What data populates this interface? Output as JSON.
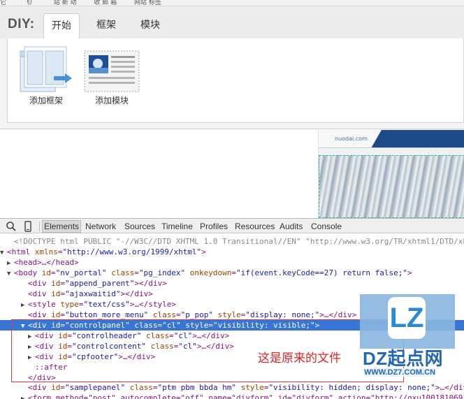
{
  "browser_strip": [
    "它",
    "飞ㄏ",
    "站 新 动",
    "收 邮 箱",
    "网站 标签"
  ],
  "diy": {
    "label": "DIY:",
    "tabs": [
      {
        "label": "开始",
        "active": true
      },
      {
        "label": "框架",
        "active": false
      },
      {
        "label": "模块",
        "active": false
      }
    ],
    "tools": {
      "add_frame": "添加框架",
      "add_module": "添加模块"
    }
  },
  "page": {
    "banner_text": "nuodai.com"
  },
  "devtools": {
    "tabs": [
      "Elements",
      "Network",
      "Sources",
      "Timeline",
      "Profiles",
      "Resources",
      "Audits",
      "Console"
    ],
    "active_tab": "Elements",
    "lines": {
      "l0": "<!DOCTYPE html PUBLIC \"-//W3C//DTD XHTML 1.0 Transitional//EN\" \"http://www.w3.org/TR/xhtml1/DTD/xh",
      "l1_tag": "<html ",
      "l1_attr": "xmlns",
      "l1_val": "\"http://www.w3.org/1999/xhtml\"",
      "l2": "<head>…</head>",
      "l3_tag": "<body ",
      "l3_a1": "id",
      "l3_v1": "\"nv_portal\"",
      "l3_a2": "class",
      "l3_v2": "\"pg_index\"",
      "l3_a3": "onkeydown",
      "l3_v3": "\"if(event.keyCode==27) return false;\"",
      "l4_a": "id",
      "l4_v": "\"append_parent\"",
      "l5_a": "id",
      "l5_v": "\"ajaxwaitid\"",
      "l6_a": "type",
      "l6_v": "\"text/css\"",
      "l7_a1": "id",
      "l7_v1": "\"button_more_menu\"",
      "l7_a2": "class",
      "l7_v2": "\"p_pop\"",
      "l7_a3": "style",
      "l7_v3": "\"display: none;\"",
      "l8_a1": "id",
      "l8_v1": "\"controlpanel\"",
      "l8_a2": "class",
      "l8_v2": "\"cl\"",
      "l8_a3": "style",
      "l8_v3": "\"visibility: visible;\"",
      "l9_a1": "id",
      "l9_v1": "\"controlheader\"",
      "l9_a2": "class",
      "l9_v2": "\"cl\"",
      "l10_a1": "id",
      "l10_v1": "\"controlcontent\"",
      "l10_a2": "class",
      "l10_v2": "\"cl\"",
      "l11_a1": "id",
      "l11_v1": "\"cpfooter\"",
      "l12": "::after",
      "l13": "</div>",
      "l14_a1": "id",
      "l14_v1": "\"samplepanel\"",
      "l14_a2": "class",
      "l14_v2": "\"ptm pbm bbda hm\"",
      "l14_a3": "style",
      "l14_v3": "\"visibility: hidden; display: none;\"",
      "l15": "<form method=\"post\" autocomplete=\"off\" name=\"diyform\" id=\"diyform\" action=\"http://qxu1001810691"
    }
  },
  "annotation": {
    "text": "这是原来的文件"
  },
  "watermark": {
    "logo": "LZ",
    "brand": "DZ起点网",
    "url": "WWW.DZ7.COM.CN"
  }
}
